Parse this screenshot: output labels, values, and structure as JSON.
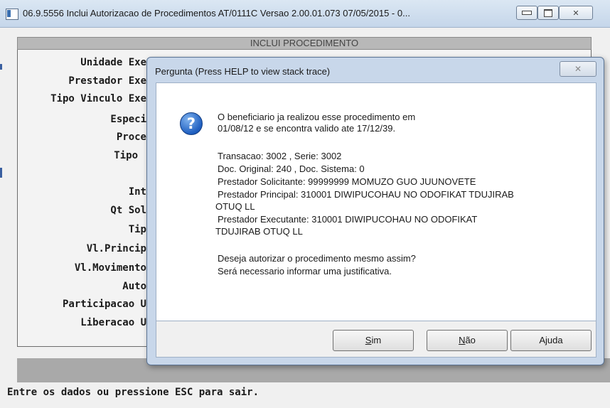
{
  "window": {
    "title": "06.9.5556   Inclui  Autorizacao de Procedimentos AT/0111C Versao 2.00.01.073 07/05/2015 - 0...",
    "close_glyph": "✕"
  },
  "form": {
    "header": "INCLUI PROCEDIMENTO",
    "labels": [
      "Unidade Exe",
      "Prestador Exe",
      "Tipo Vinculo Exe",
      "Especi",
      "Proce",
      "Tipo",
      "Int",
      "Qt Sol",
      "Tip",
      "Vl.Princip",
      "Vl.Movimento",
      "Auto",
      "Participacao U",
      "Liberacao U"
    ],
    "status": "Entre os dados ou pressione ESC para sair."
  },
  "dialog": {
    "title": "Pergunta (Press HELP to view stack trace)",
    "close_glyph": "✕",
    "icon": "question-icon",
    "message_lines": [
      "O beneficiario ja realizou esse procedimento em",
      "01/08/12  e se encontra valido ate 17/12/39.",
      "Transacao:  3002 , Serie:  3002",
      "Doc. Original:  240 , Doc. Sistema:  0",
      "Prestador Solicitante:  99999999 MOMUZO GUO JUUNOVETE",
      "Prestador Principal:  310001 DIWIPUCOHAU NO ODOFIKAT TDUJIRAB",
      "OTUQ LL",
      "Prestador Executante:  310001 DIWIPUCOHAU NO ODOFIKAT",
      "TDUJIRAB OTUQ LL",
      "Deseja autorizar o procedimento mesmo assim?",
      "Será necessario informar uma justificativa."
    ],
    "buttons": {
      "sim_first": "S",
      "sim_rest": "im",
      "nao_first": "N",
      "nao_rest": "ão",
      "ajuda": "Ajuda"
    }
  }
}
